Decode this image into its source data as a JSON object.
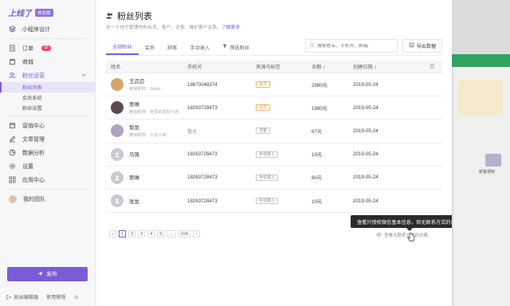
{
  "brand": {
    "name": "上线了",
    "badge": "体验版"
  },
  "sidebar": {
    "items": [
      {
        "label": "小程序设计",
        "icon": "layers-icon"
      },
      {
        "label": "订单",
        "icon": "document-icon",
        "badge": "16"
      },
      {
        "label": "商城",
        "icon": "shop-icon"
      },
      {
        "label": "粉丝运营",
        "icon": "users-icon",
        "active": true
      },
      {
        "label": "营销中心",
        "icon": "calendar-icon"
      },
      {
        "label": "文章管理",
        "icon": "pen-icon"
      },
      {
        "label": "数据分析",
        "icon": "chart-icon"
      },
      {
        "label": "设置",
        "icon": "gear-icon"
      },
      {
        "label": "应用中心",
        "icon": "grid-icon"
      },
      {
        "label": "我的团队",
        "icon": "avatar"
      }
    ],
    "sub_items": [
      "粉丝列表",
      "会员系统",
      "粉丝设置"
    ],
    "publish_label": "发布",
    "footer": {
      "logout": "退出编辑器",
      "tutorial": "使用教程"
    }
  },
  "page": {
    "title": "粉丝列表",
    "subtitle": "这一个地方管理你的会员、客户、访客、维护客户关系。",
    "subtitle_link": "了解更多"
  },
  "tabs": [
    {
      "label": "全部粉丝",
      "active": true
    },
    {
      "label": "会员"
    },
    {
      "label": "顾客"
    },
    {
      "label": "手动录入"
    },
    {
      "label": "筛选粉丝"
    }
  ],
  "search": {
    "placeholder": "搜索姓名、手机号、邮箱"
  },
  "export_label": "导出数据",
  "table": {
    "headers": [
      "姓名",
      "手机号",
      "来源与标签",
      "余额 ↕",
      "创建日期 ↕"
    ],
    "rows": [
      {
        "name": "王迈迈",
        "nick": "微信昵称：Justin",
        "phone": "18673048374",
        "tag": "会员",
        "tag_style": "orange",
        "balance": "2980元",
        "date": "2019-05-24"
      },
      {
        "name": "贾琳",
        "nick": "微信昵称：老贾的发财小店",
        "phone": "18263728473",
        "tag": "会员",
        "tag_style": "orange",
        "balance": "1980元",
        "date": "2019-05-24"
      },
      {
        "name": "智龙",
        "nick": "微信昵称：小龙子草",
        "phone": "暂无",
        "tag": "访客",
        "tag_style": "gray",
        "balance": "67元",
        "date": "2019-05-24"
      },
      {
        "name": "马强",
        "nick": "",
        "phone": "18263728473",
        "tag": "手动录入",
        "tag_style": "gray",
        "balance": "10元",
        "date": "2019-05-24"
      },
      {
        "name": "贾琳",
        "nick": "",
        "phone": "18263728473",
        "tag": "手动录入",
        "tag_style": "gray",
        "balance": "80元",
        "date": "2019-05-24"
      },
      {
        "name": "张龙",
        "nick": "",
        "phone": "18263728473",
        "tag": "手动录入",
        "tag_style": "gray",
        "balance": "10元",
        "date": "2019-05-24"
      }
    ]
  },
  "pagination": {
    "pages": [
      "‹",
      "1",
      "2",
      "3",
      "4",
      "5",
      "…",
      "104",
      "›"
    ],
    "current": "1"
  },
  "hint": {
    "link": "查看无联系方式的访客",
    "tooltip": "查看只授权微信基本信息，但无联系方式的访客。"
  },
  "preview": {
    "label": "新客通知"
  }
}
